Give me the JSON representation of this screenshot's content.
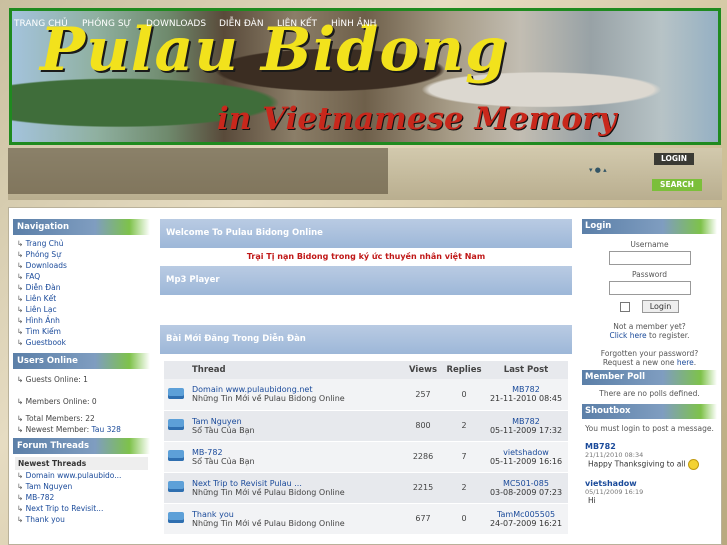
{
  "banner": {
    "title": "Pulau Bidong",
    "subtitle": "in Vietnamese Memory"
  },
  "nav": {
    "items": [
      "TRANG CHỦ",
      "PHÓNG SỰ",
      "DOWNLOADS",
      "DIỄN ĐÀN",
      "LIÊN KẾT",
      "HÌNH ẢNH"
    ]
  },
  "header_buttons": {
    "login": "LOGIN",
    "search": "SEARCH"
  },
  "navigation": {
    "title": "Navigation",
    "links": [
      "Trang Chủ",
      "Phóng Sự",
      "Downloads",
      "FAQ",
      "Diễn Đàn",
      "Liên Kết",
      "Liên Lạc",
      "Hình Ảnh",
      "Tìm Kiếm",
      "Guestbook"
    ]
  },
  "users_online": {
    "title": "Users Online",
    "guests": "Guests Online: 1",
    "members": "Members Online: 0",
    "total": "Total Members: 22",
    "newest_label": "Newest Member:",
    "newest_name": "Tau 328"
  },
  "forum_threads": {
    "title": "Forum Threads",
    "subtitle": "Newest Threads",
    "items": [
      "Domain www.pulaubido...",
      "Tam Nguyen",
      "MB-782",
      "Next Trip to Revisit...",
      "Thank you"
    ]
  },
  "center": {
    "welcome": "Welcome To Pulau Bidong Online",
    "tagline": "Trại Tị nạn Bidong trong ký ức thuyền nhân việt Nam",
    "mp3": "Mp3 Player",
    "latest": "Bài Mới Đăng Trong Diễn Đàn",
    "columns": [
      "Thread",
      "Views",
      "Replies",
      "Last Post"
    ],
    "rows": [
      {
        "thread": "Domain www.pulaubidong.net",
        "forum": "Những Tin Mới về Pulau Bidong Online",
        "views": "257",
        "replies": "0",
        "user": "MB782",
        "date": "21-11-2010 08:45"
      },
      {
        "thread": "Tam Nguyen",
        "forum": "Sổ Tàu Của Bạn",
        "views": "800",
        "replies": "2",
        "user": "MB782",
        "date": "05-11-2009 17:32"
      },
      {
        "thread": "MB-782",
        "forum": "Sổ Tàu Của Bạn",
        "views": "2286",
        "replies": "7",
        "user": "vietshadow",
        "date": "05-11-2009 16:16"
      },
      {
        "thread": "Next Trip to Revisit Pulau ...",
        "forum": "Những Tin Mới về Pulau Bidong Online",
        "views": "2215",
        "replies": "2",
        "user": "MC501-085",
        "date": "03-08-2009 07:23"
      },
      {
        "thread": "Thank you",
        "forum": "Những Tin Mới về Pulau Bidong Online",
        "views": "677",
        "replies": "0",
        "user": "TamMc005505",
        "date": "24-07-2009 16:21"
      }
    ]
  },
  "login": {
    "title": "Login",
    "username_label": "Username",
    "password_label": "Password",
    "button": "Login",
    "not_member": "Not a member yet?",
    "click_here": "Click here",
    "to_register": "to register.",
    "forgotten": "Forgotten your password?",
    "request": "Request a new one",
    "here": "here",
    "dot": "."
  },
  "poll": {
    "title": "Member Poll",
    "text": "There are no polls defined."
  },
  "shoutbox": {
    "title": "Shoutbox",
    "notice": "You must login to post a message.",
    "shouts": [
      {
        "name": "MB782",
        "date": "21/11/2010 08:34",
        "msg": "Happy Thanksgiving to all"
      },
      {
        "name": "vietshadow",
        "date": "05/11/2009 16:19",
        "msg": "Hi"
      }
    ]
  }
}
